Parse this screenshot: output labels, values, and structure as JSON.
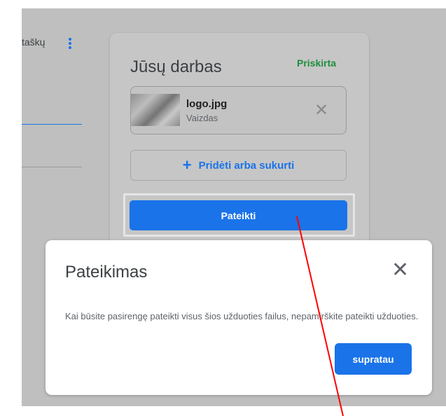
{
  "left_panel": {
    "points_text": "taškų"
  },
  "work_card": {
    "title": "Jūsų darbas",
    "status": "Priskirta",
    "attachment": {
      "file_name": "logo.jpg",
      "file_type": "Vaizdas"
    },
    "add_button_label": "Pridėti arba sukurti",
    "submit_button_label": "Pateikti"
  },
  "dialog": {
    "title": "Pateikimas",
    "message": "Kai būsite pasirengę pateikti visus šios užduoties failus, nepamirškite pateikti užduoties.",
    "confirm_button_label": "supratau"
  },
  "icons": {
    "more": "more-vert-icon",
    "remove": "close-icon",
    "add": "plus-icon",
    "dialog_close": "close-icon"
  },
  "colors": {
    "accent": "#1a73e8",
    "status_green": "#1e8e3e",
    "overlay_gray": "#bfbfbf",
    "pointer_red": "#ff0000"
  }
}
